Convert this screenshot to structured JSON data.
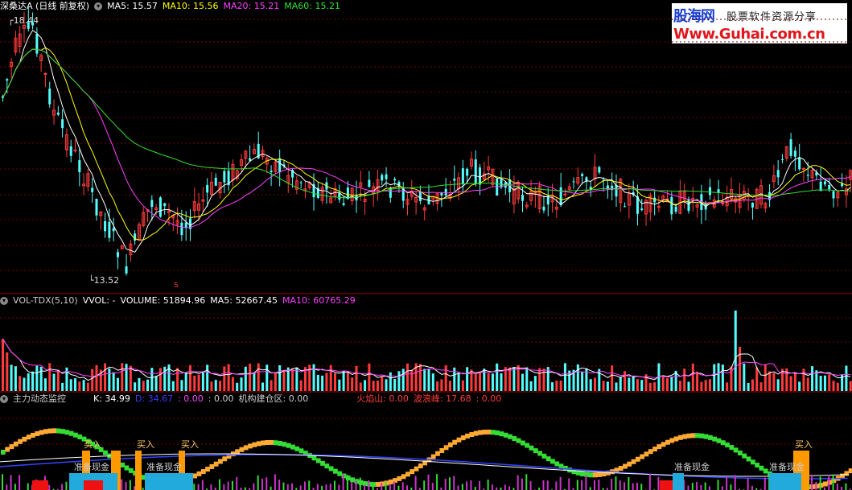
{
  "main": {
    "title": "深桑达A (日线 前复权)",
    "ma5": "MA5: 15.57",
    "ma10": "MA10: 15.56",
    "ma20": "MA20: 15.21",
    "ma60": "MA60: 15.21",
    "high_label": "18.44",
    "low_label": "13.52",
    "marker": "S"
  },
  "vol": {
    "title": "VOL-TDX(5,10)",
    "vvol": "VVOL: -",
    "volume": "VOLUME: 51894.96",
    "ma5": "MA5: 52667.45",
    "ma10": "MA10: 60765.29"
  },
  "indicator": {
    "title": "主力动态监控",
    "k": "K: 34.99",
    "d": "D: 34.67",
    "v1": ": 0.00",
    "v2": ": 0.00",
    "jigou": "机构建仓区: 0.00",
    "huoyan": "火焰山: 0.00",
    "bolang": "波浪峰: 17.68",
    "v3": ": 0.00",
    "buy": "买入",
    "prepare": "准备现金"
  },
  "logo": {
    "name": "股海网",
    "slogan": "股票软件资源分享",
    "url": "Www.Guhai.com.cn"
  },
  "colors": {
    "up": "#ff3b3b",
    "down": "#54ffff",
    "ma5": "#ffffff",
    "ma10": "#ffff00",
    "ma20": "#ff40ff",
    "ma60": "#30e030",
    "grid": "#7a0000"
  }
}
